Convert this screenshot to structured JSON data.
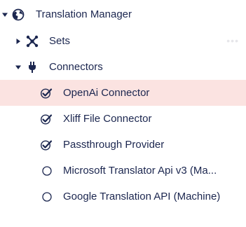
{
  "tree": {
    "root": {
      "label": "Translation Manager",
      "icon": "globe-icon",
      "expanded": true
    },
    "sets": {
      "label": "Sets",
      "icon": "sets-icon",
      "expanded": false,
      "actions_icon": "more-icon"
    },
    "connectors": {
      "label": "Connectors",
      "icon": "plug-icon",
      "expanded": true,
      "items": [
        {
          "label": "OpenAi Connector",
          "status": "check-icon",
          "selected": true
        },
        {
          "label": "Xliff File Connector",
          "status": "check-icon",
          "selected": false
        },
        {
          "label": "Passthrough Provider",
          "status": "check-icon",
          "selected": false
        },
        {
          "label": "Microsoft Translator Api v3 (Ma...",
          "status": "circle-icon",
          "selected": false
        },
        {
          "label": "Google Translation API (Machine)",
          "status": "circle-icon",
          "selected": false
        }
      ]
    }
  },
  "colors": {
    "text": "#1b264f",
    "selected_background": "#fbe3e1"
  }
}
